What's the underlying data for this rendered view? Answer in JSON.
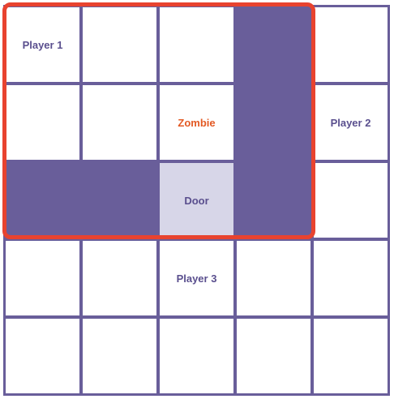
{
  "colors": {
    "grid": "#695e9a",
    "wall": "#695e9a",
    "door": "#d7d6e8",
    "player_text": "#5a4f8e",
    "zombie_text": "#e35a24",
    "highlight": "#e8432f"
  },
  "board": {
    "rows": 5,
    "cols": 5,
    "cells": [
      [
        "player",
        "empty",
        "empty",
        "wall",
        "empty"
      ],
      [
        "empty",
        "empty",
        "zombie",
        "wall",
        "player"
      ],
      [
        "wall",
        "wall",
        "door",
        "wall",
        "empty"
      ],
      [
        "empty",
        "empty",
        "player",
        "empty",
        "empty"
      ],
      [
        "empty",
        "empty",
        "empty",
        "empty",
        "empty"
      ]
    ],
    "labels": {
      "player_1": "Player 1",
      "player_2": "Player 2",
      "player_3": "Player 3",
      "zombie": "Zombie",
      "door": "Door"
    }
  }
}
